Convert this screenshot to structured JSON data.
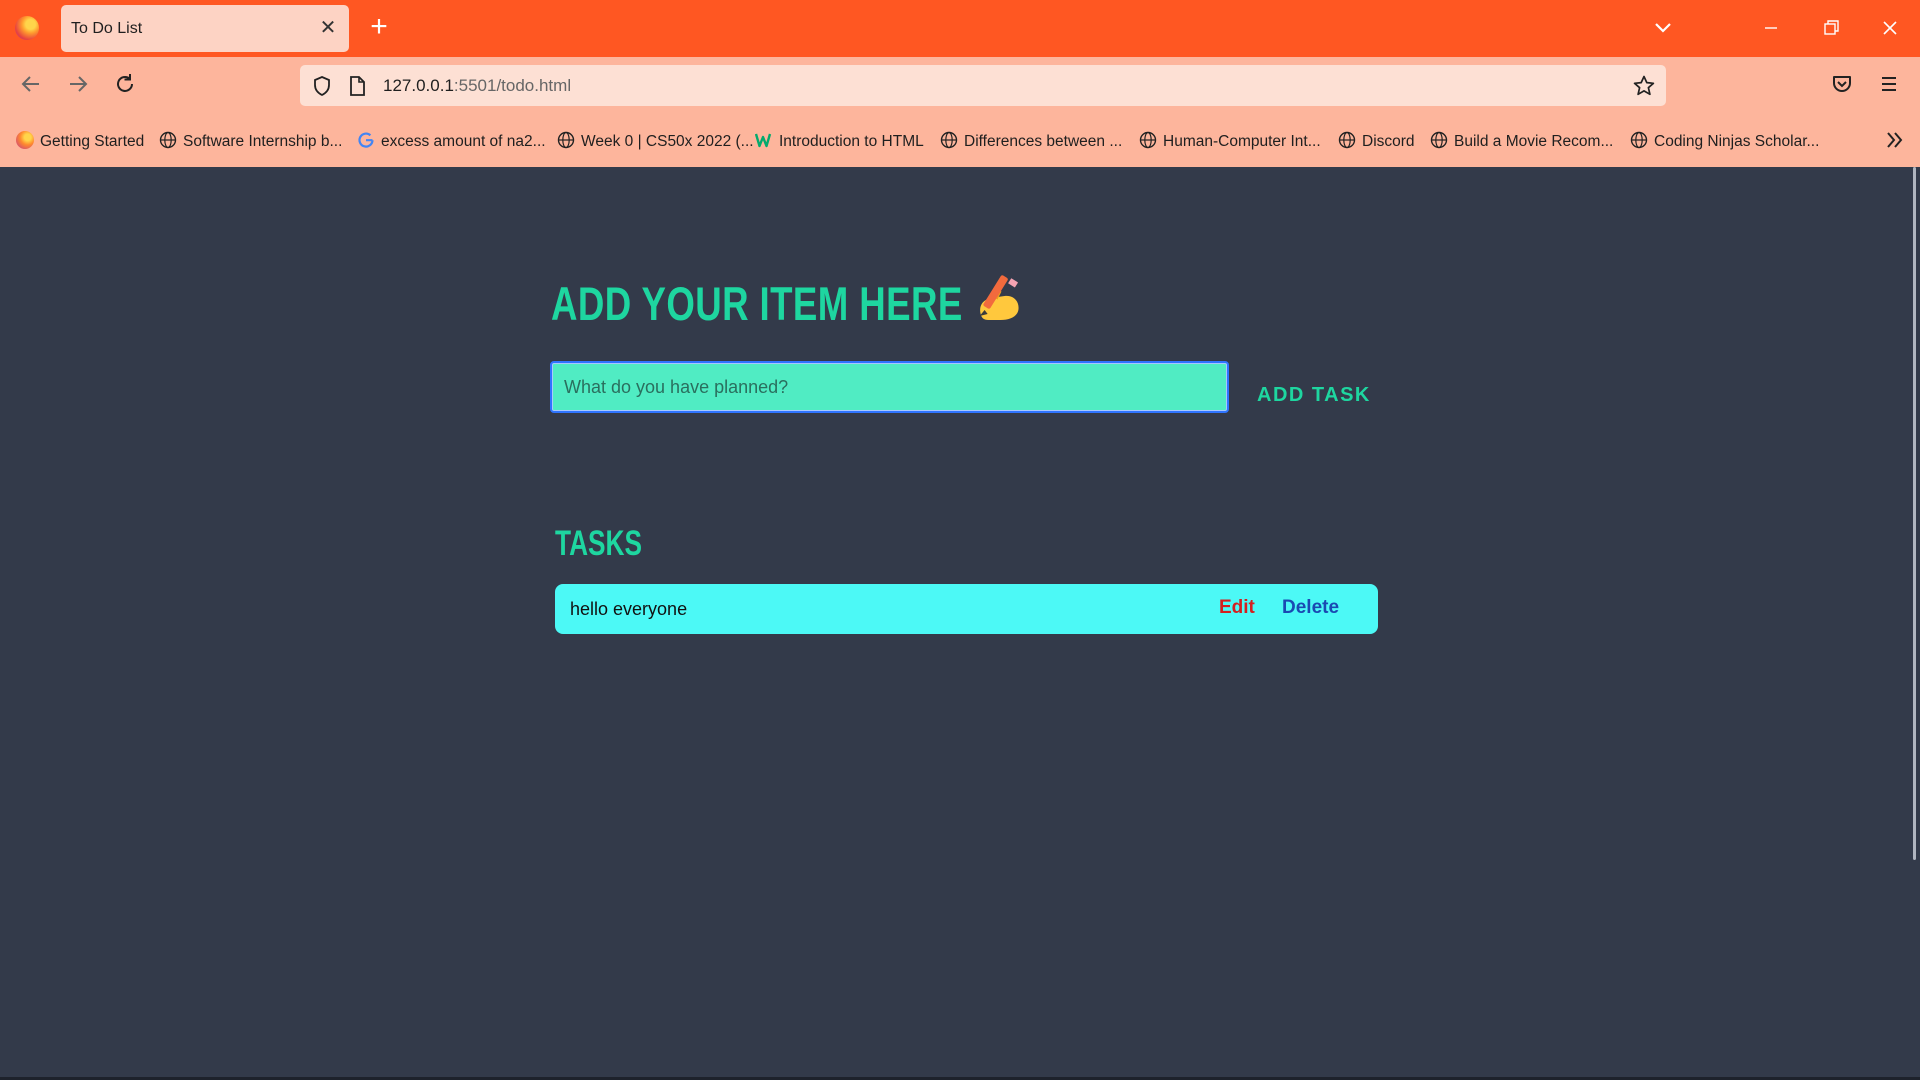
{
  "browser": {
    "tab": {
      "title": "To Do List"
    },
    "url": {
      "host": "127.0.0.1",
      "rest": ":5501/todo.html"
    },
    "bookmarks": [
      {
        "label": "Getting Started",
        "icon": "firefox-icon"
      },
      {
        "label": "Software Internship b...",
        "icon": "globe-icon"
      },
      {
        "label": "excess amount of na2...",
        "icon": "google-icon"
      },
      {
        "label": "Week 0 | CS50x 2022 (...",
        "icon": "globe-icon"
      },
      {
        "label": "Introduction to HTML",
        "icon": "w3schools-icon"
      },
      {
        "label": "Differences between ...",
        "icon": "globe-icon"
      },
      {
        "label": "Human-Computer Int...",
        "icon": "globe-icon"
      },
      {
        "label": "Discord",
        "icon": "globe-icon"
      },
      {
        "label": "Build a Movie Recom...",
        "icon": "globe-icon"
      },
      {
        "label": "Coding Ninjas Scholar...",
        "icon": "globe-icon"
      }
    ],
    "colors": {
      "tab_strip": "#ff5722",
      "toolbar": "#fdb59c"
    }
  },
  "app": {
    "heading": "ADD YOUR ITEM HERE",
    "heading_icon": "writing-hand-icon",
    "input": {
      "placeholder": "What do you have planned?",
      "value": ""
    },
    "add_button": "ADD TASK",
    "tasks_heading": "TASKS",
    "tasks": [
      {
        "text": "hello everyone",
        "edit": "Edit",
        "delete": "Delete"
      }
    ],
    "colors": {
      "accent": "#1ed6a0",
      "input_bg": "#50ecc3",
      "task_bg": "#4cf9f6",
      "edit": "#d41f1f",
      "delete": "#1a4ab2",
      "page_bg": "#333a4a"
    }
  }
}
